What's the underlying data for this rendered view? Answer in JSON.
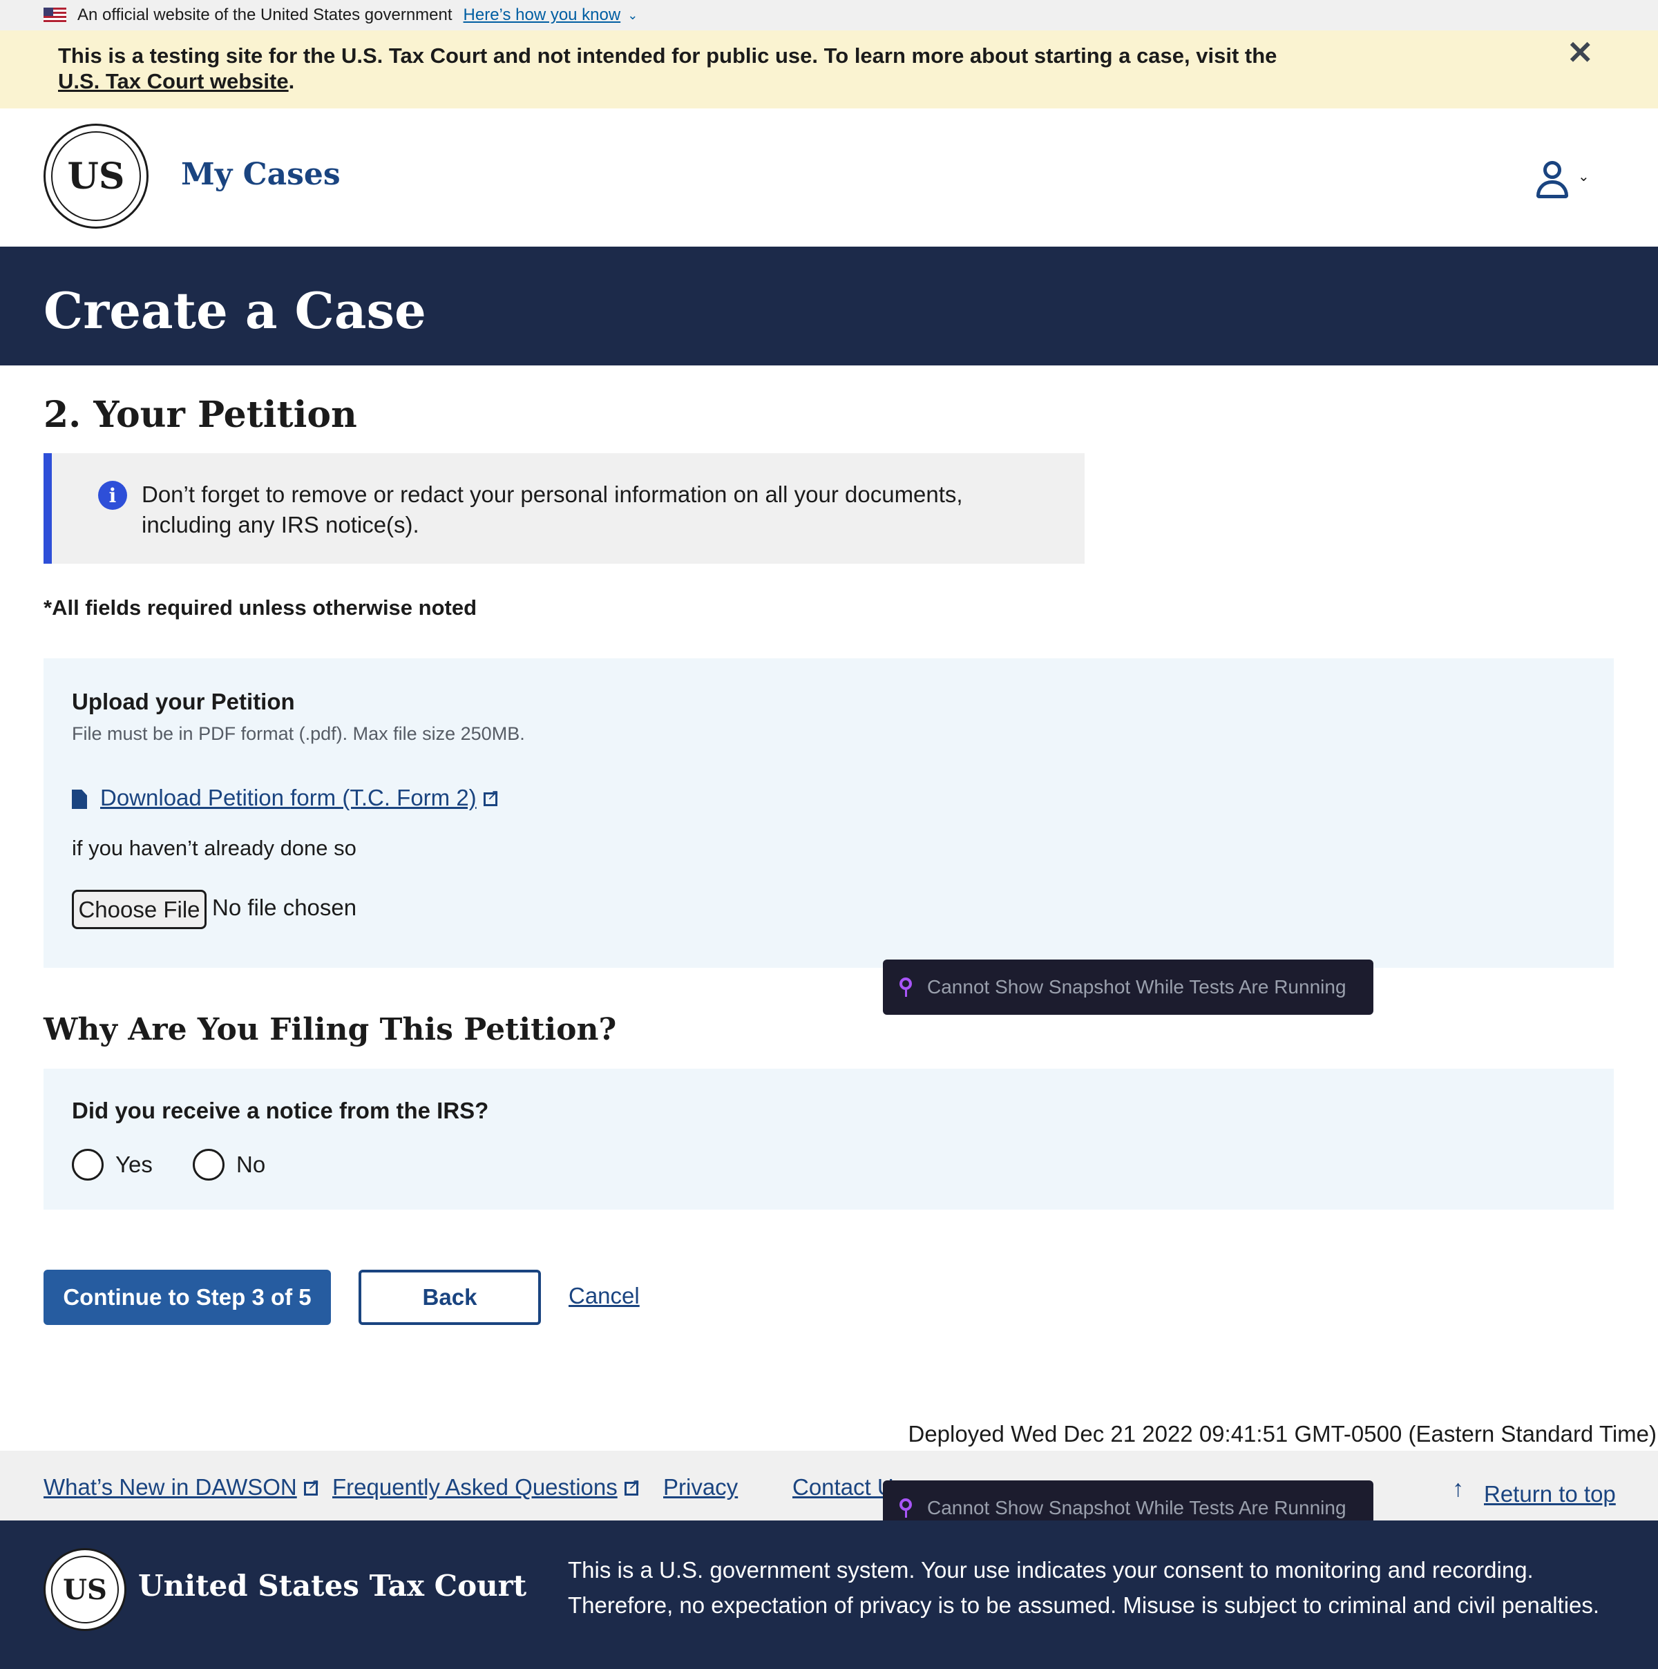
{
  "gov_banner": {
    "text": "An official website of the United States government",
    "how_link": "Here’s how you know"
  },
  "testing_banner": {
    "text": "This is a testing site for the U.S. Tax Court and not intended for public use. To learn more about starting a case, visit the ",
    "link": "U.S. Tax Court website",
    "end": ".",
    "close_icon": "close-icon"
  },
  "header": {
    "seal_text": "US",
    "nav_title": "My Cases",
    "user_icon": "user-icon"
  },
  "page": {
    "title": "Create a Case",
    "step_title": "2. Your Petition",
    "alert_text": "Don’t forget to remove or redact your personal information on all your documents, including any IRS notice(s).",
    "required_note": "*All fields required unless otherwise noted"
  },
  "upload": {
    "label": "Upload your Petition",
    "hint": "File must be in PDF format (.pdf). Max file size 250MB.",
    "download_link": "Download Petition form (T.C. Form 2)",
    "already": "if you haven’t already done so",
    "choose_button": "Choose File",
    "file_status": "No file chosen"
  },
  "snapshot_overlay": {
    "text": "Cannot Show Snapshot While Tests Are Running"
  },
  "why": {
    "heading": "Why Are You Filing This Petition?",
    "question": "Did you receive a notice from the IRS?",
    "options": [
      "Yes",
      "No"
    ]
  },
  "actions": {
    "continue": "Continue to Step 3 of 5",
    "back": "Back",
    "cancel": "Cancel"
  },
  "deployed": "Deployed Wed Dec 21 2022 09:41:51 GMT-0500 (Eastern Standard Time)",
  "footer_links": {
    "whats_new": "What’s New in DAWSON",
    "faq": "Frequently Asked Questions",
    "privacy": "Privacy",
    "contact": "Contact U",
    "return_top": "Return to top"
  },
  "footer": {
    "seal_text": "US",
    "court_name": "United States Tax Court",
    "notice": "This is a U.S. government system. Your use indicates your consent to monitoring and recording. Therefore, no expectation of privacy is to be assumed. Misuse is subject to criminal and civil penalties."
  },
  "colors": {
    "navy": "#1c2a4a",
    "link_blue": "#1a4480",
    "primary_button": "#265ca0",
    "test_banner_bg": "#faf3d1",
    "form_box_bg": "#eff6fb",
    "info_accent": "#2e4fd8"
  }
}
